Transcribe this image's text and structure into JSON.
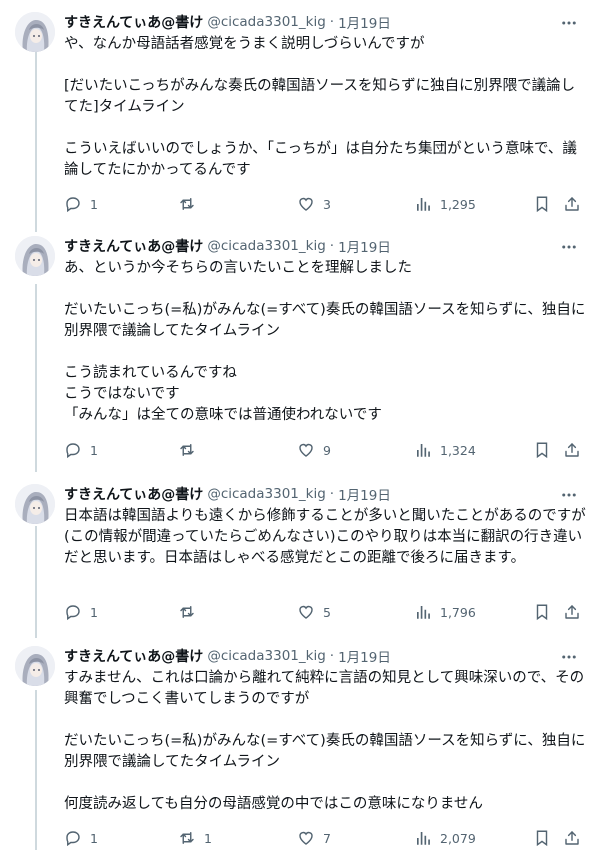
{
  "colors": {
    "text": "#0f1419",
    "secondary": "#536471",
    "thread_line": "#cfd9de"
  },
  "tweets": [
    {
      "name": "すきえんてぃあ@書け",
      "handle": "@cicada3301_kig",
      "separator": "·",
      "date": "1月19日",
      "text": "や、なんか母語話者感覚をうまく説明しづらいんですが\n\n[だいたいこっちがみんな奏氏の韓国語ソースを知らずに独自に別界隈で議論してた]タイムライン\n\nこういえばいいのでしょうか、「こっちが」は自分たち集団がという意味で、議論してたにかかってるんです",
      "replies": "1",
      "retweets": "",
      "likes": "3",
      "views": "1,295"
    },
    {
      "name": "すきえんてぃあ@書け",
      "handle": "@cicada3301_kig",
      "separator": "·",
      "date": "1月19日",
      "text": "あ、というか今そちらの言いたいことを理解しました\n\nだいたいこっち(=私)がみんな(=すべて)奏氏の韓国語ソースを知らずに、独自に別界隈で議論してたタイムライン\n\nこう読まれているんですね\nこうではないです\n「みんな」は全ての意味では普通使われないです",
      "replies": "1",
      "retweets": "",
      "likes": "9",
      "views": "1,324"
    },
    {
      "name": "すきえんてぃあ@書け",
      "handle": "@cicada3301_kig",
      "separator": "·",
      "date": "1月19日",
      "text": "日本語は韓国語よりも遠くから修飾することが多いと聞いたことがあるのですが(この情報が間違っていたらごめんなさい)このやり取りは本当に翻訳の行き違いだと思います。日本語はしゃべる感覚だとこの距離で後ろに届きます。",
      "replies": "1",
      "retweets": "",
      "likes": "5",
      "views": "1,796"
    },
    {
      "name": "すきえんてぃあ@書け",
      "handle": "@cicada3301_kig",
      "separator": "·",
      "date": "1月19日",
      "text": "すみません、これは口論から離れて純粋に言語の知見として興味深いので、その興奮でしつこく書いてしまうのですが\n\nだいたいこっち(=私)がみんな(=すべて)奏氏の韓国語ソースを知らずに、独自に別界隈で議論してたタイムライン\n\n何度読み返しても自分の母語感覚の中ではこの意味になりません",
      "replies": "1",
      "retweets": "1",
      "likes": "7",
      "views": "2,079"
    }
  ]
}
